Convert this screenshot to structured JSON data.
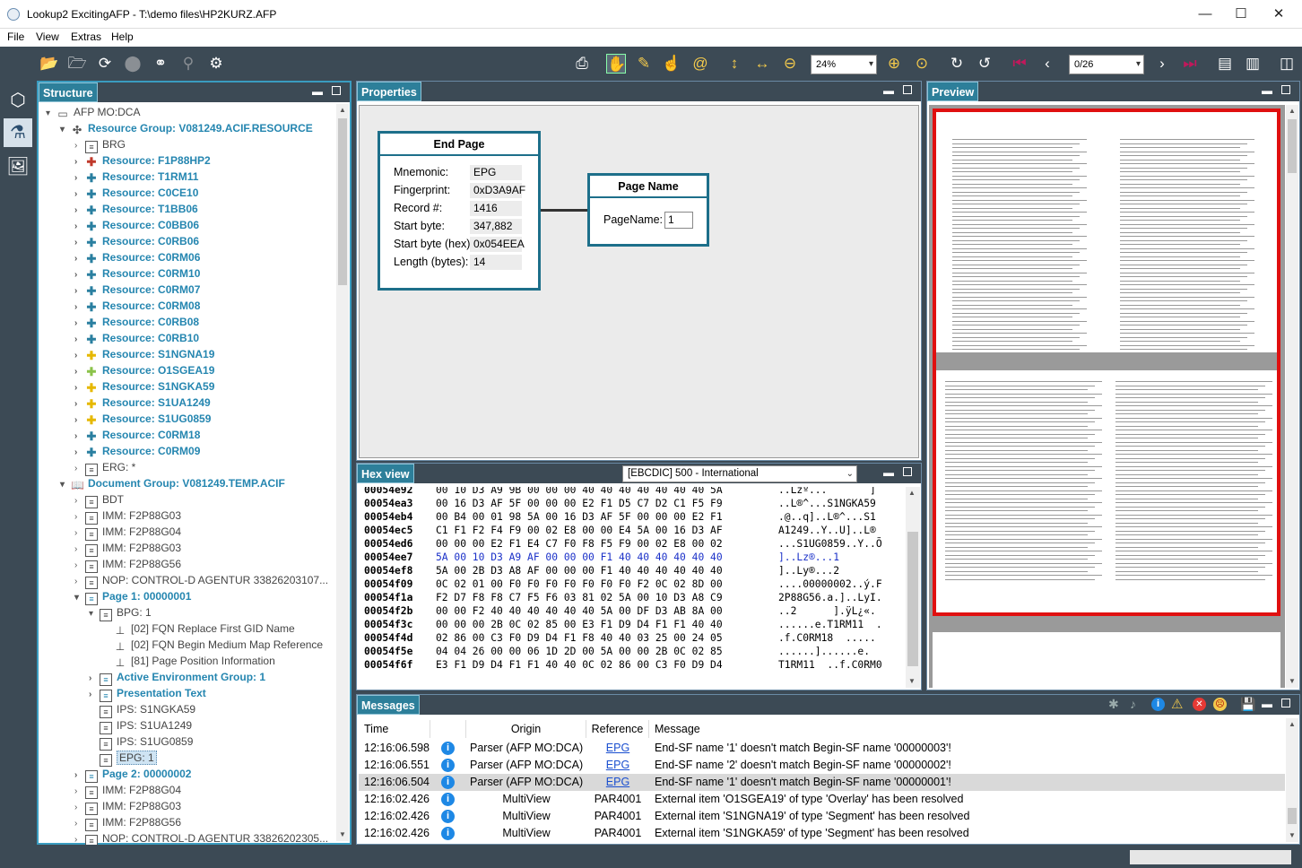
{
  "window": {
    "title": "Lookup2 ExcitingAFP - T:\\demo files\\HP2KURZ.AFP",
    "minimize": "—",
    "maximize": "☐",
    "close": "✕"
  },
  "menu": [
    "File",
    "View",
    "Extras",
    "Help"
  ],
  "toolbar": {
    "zoom": "24%",
    "page": "0/26"
  },
  "structure": {
    "title": "Structure",
    "nodes": [
      {
        "label": "AFP MO:DCA",
        "icon": "afp-file-icon",
        "style": "norm",
        "twisty": "▾",
        "indent": 0
      },
      {
        "label": "Resource Group: V081249.ACIF.RESOURCE",
        "icon": "resource-group-icon",
        "style": "bold",
        "twisty": "▾",
        "indent": 1
      },
      {
        "label": "BRG",
        "icon": "doc",
        "style": "norm",
        "twisty": "›",
        "indent": 2
      },
      {
        "label": "Resource: F1P88HP2",
        "icon": "pzr",
        "style": "bold",
        "twisty": "›",
        "indent": 2
      },
      {
        "label": "Resource: T1RM11",
        "icon": "pz",
        "style": "bold",
        "twisty": "›",
        "indent": 2
      },
      {
        "label": "Resource: C0CE10",
        "icon": "pz",
        "style": "bold",
        "twisty": "›",
        "indent": 2
      },
      {
        "label": "Resource: T1BB06",
        "icon": "pz",
        "style": "bold",
        "twisty": "›",
        "indent": 2
      },
      {
        "label": "Resource: C0BB06",
        "icon": "pz",
        "style": "bold",
        "twisty": "›",
        "indent": 2
      },
      {
        "label": "Resource: C0RB06",
        "icon": "pz",
        "style": "bold",
        "twisty": "›",
        "indent": 2
      },
      {
        "label": "Resource: C0RM06",
        "icon": "pz",
        "style": "bold",
        "twisty": "›",
        "indent": 2
      },
      {
        "label": "Resource: C0RM10",
        "icon": "pz",
        "style": "bold",
        "twisty": "›",
        "indent": 2
      },
      {
        "label": "Resource: C0RM07",
        "icon": "pz",
        "style": "bold",
        "twisty": "›",
        "indent": 2
      },
      {
        "label": "Resource: C0RM08",
        "icon": "pz",
        "style": "bold",
        "twisty": "›",
        "indent": 2
      },
      {
        "label": "Resource: C0RB08",
        "icon": "pz",
        "style": "bold",
        "twisty": "›",
        "indent": 2
      },
      {
        "label": "Resource: C0RB10",
        "icon": "pz",
        "style": "bold",
        "twisty": "›",
        "indent": 2
      },
      {
        "label": "Resource: S1NGNA19",
        "icon": "pzy",
        "style": "bold",
        "twisty": "›",
        "indent": 2
      },
      {
        "label": "Resource: O1SGEA19",
        "icon": "pzg",
        "style": "bold",
        "twisty": "›",
        "indent": 2
      },
      {
        "label": "Resource: S1NGKA59",
        "icon": "pzy",
        "style": "bold",
        "twisty": "›",
        "indent": 2
      },
      {
        "label": "Resource: S1UA1249",
        "icon": "pzy",
        "style": "bold",
        "twisty": "›",
        "indent": 2
      },
      {
        "label": "Resource: S1UG0859",
        "icon": "pzy",
        "style": "bold",
        "twisty": "›",
        "indent": 2
      },
      {
        "label": "Resource: C0RM18",
        "icon": "pz",
        "style": "bold",
        "twisty": "›",
        "indent": 2
      },
      {
        "label": "Resource: C0RM09",
        "icon": "pz",
        "style": "bold",
        "twisty": "›",
        "indent": 2
      },
      {
        "label": "ERG: *",
        "icon": "doc",
        "style": "norm",
        "twisty": "›",
        "indent": 2
      },
      {
        "label": "Document Group: V081249.TEMP.ACIF",
        "icon": "book-icon",
        "style": "bold",
        "twisty": "▾",
        "indent": 1
      },
      {
        "label": "BDT",
        "icon": "doc",
        "style": "norm",
        "twisty": "›",
        "indent": 2
      },
      {
        "label": "IMM: F2P88G03",
        "icon": "doc",
        "style": "norm",
        "twisty": "›",
        "indent": 2
      },
      {
        "label": "IMM: F2P88G04",
        "icon": "doc",
        "style": "norm",
        "twisty": "›",
        "indent": 2
      },
      {
        "label": "IMM: F2P88G03",
        "icon": "doc",
        "style": "norm",
        "twisty": "›",
        "indent": 2
      },
      {
        "label": "IMM: F2P88G56",
        "icon": "doc",
        "style": "norm",
        "twisty": "›",
        "indent": 2
      },
      {
        "label": "NOP: CONTROL-D AGENTUR  33826203107...",
        "icon": "doc",
        "style": "norm",
        "twisty": "›",
        "indent": 2
      },
      {
        "label": "Page 1: 00000001",
        "icon": "doc",
        "style": "bold",
        "twisty": "▾",
        "indent": 2
      },
      {
        "label": "BPG: 1",
        "icon": "doc",
        "style": "norm",
        "twisty": "▾",
        "indent": 3
      },
      {
        "label": "[02] FQN Replace First GID Name",
        "icon": "triplet",
        "style": "norm",
        "twisty": "",
        "indent": 4
      },
      {
        "label": "[02] FQN Begin Medium Map Reference",
        "icon": "triplet",
        "style": "norm",
        "twisty": "",
        "indent": 4
      },
      {
        "label": "[81] Page Position Information",
        "icon": "triplet",
        "style": "norm",
        "twisty": "",
        "indent": 4
      },
      {
        "label": "Active Environment Group: 1",
        "icon": "doc",
        "style": "bold",
        "twisty": "›",
        "indent": 3
      },
      {
        "label": "Presentation Text",
        "icon": "doc",
        "style": "bold",
        "twisty": "›",
        "indent": 3
      },
      {
        "label": "IPS: S1NGKA59",
        "icon": "doc",
        "style": "norm",
        "twisty": "",
        "indent": 3
      },
      {
        "label": "IPS: S1UA1249",
        "icon": "doc",
        "style": "norm",
        "twisty": "",
        "indent": 3
      },
      {
        "label": "IPS: S1UG0859",
        "icon": "doc",
        "style": "norm",
        "twisty": "",
        "indent": 3
      },
      {
        "label": "EPG: 1",
        "icon": "doc",
        "style": "sel",
        "twisty": "",
        "indent": 3
      },
      {
        "label": "Page 2: 00000002",
        "icon": "doc",
        "style": "bold",
        "twisty": "›",
        "indent": 2
      },
      {
        "label": "IMM: F2P88G04",
        "icon": "doc",
        "style": "norm",
        "twisty": "›",
        "indent": 2
      },
      {
        "label": "IMM: F2P88G03",
        "icon": "doc",
        "style": "norm",
        "twisty": "›",
        "indent": 2
      },
      {
        "label": "IMM: F2P88G56",
        "icon": "doc",
        "style": "norm",
        "twisty": "›",
        "indent": 2
      },
      {
        "label": "NOP: CONTROL-D AGENTUR  33826202305...",
        "icon": "doc",
        "style": "norm",
        "twisty": "›",
        "indent": 2
      }
    ]
  },
  "properties": {
    "title": "Properties",
    "end_page": {
      "header": "End Page",
      "fields": [
        {
          "label": "Mnemonic:",
          "value": "EPG"
        },
        {
          "label": "Fingerprint:",
          "value": "0xD3A9AF"
        },
        {
          "label": "Record #:",
          "value": "1416"
        },
        {
          "label": "Start byte:",
          "value": "347,882"
        },
        {
          "label": "Start byte (hex):",
          "value": "0x054EEA"
        },
        {
          "label": "Length (bytes):",
          "value": "14"
        }
      ]
    },
    "page_name": {
      "header": "Page Name",
      "label": "PageName:",
      "value": "1"
    }
  },
  "hexview": {
    "title": "Hex view",
    "encoding": "[EBCDIC] 500  - International",
    "rows": [
      {
        "addr": "00054e92",
        "bytes": "00 10 D3 A9 9B 00 00 00 40 40 40 40 40 40 40 5A",
        "text": "..Lzº...       ]"
      },
      {
        "addr": "00054ea3",
        "bytes": "00 16 D3 AF 5F 00 00 00 E2 F1 D5 C7 D2 C1 F5 F9",
        "text": "..L®^...S1NGKA59"
      },
      {
        "addr": "00054eb4",
        "bytes": "00 B4 00 01 98 5A 00 16 D3 AF 5F 00 00 00 E2 F1",
        "text": ".@..q]..L®^...S1"
      },
      {
        "addr": "00054ec5",
        "bytes": "C1 F1 F2 F4 F9 00 02 E8 00 00 E4 5A 00 16 D3 AF",
        "text": "A1249..Y..U]..L®"
      },
      {
        "addr": "00054ed6",
        "bytes": "00 00 00 E2 F1 E4 C7 F0 F8 F5 F9 00 02 E8 00 02",
        "text": "...S1UG0859..Y..Õ"
      },
      {
        "addr": "00054ee7",
        "bytes": "5A 00 10 D3 A9 AF 00 00 00 F1 40 40 40 40 40 40",
        "text": "]..Lz®...1      "
      },
      {
        "addr": "00054ef8",
        "bytes": "5A 00 2B D3 A8 AF 00 00 00 F1 40 40 40 40 40 40",
        "text": "]..Ly®...2      "
      },
      {
        "addr": "00054f09",
        "bytes": "0C 02 01 00 F0 F0 F0 F0 F0 F0 F0 F2 0C 02 8D 00",
        "text": "....00000002..ý.F"
      },
      {
        "addr": "00054f1a",
        "bytes": "F2 D7 F8 F8 C7 F5 F6 03 81 02 5A 00 10 D3 A8 C9",
        "text": "2P88G56.a.]..LyI."
      },
      {
        "addr": "00054f2b",
        "bytes": "00 00 F2 40 40 40 40 40 40 5A 00 DF D3 AB 8A 00",
        "text": "..2      ].ÿL¿«."
      },
      {
        "addr": "00054f3c",
        "bytes": "00 00 00 2B 0C 02 85 00 E3 F1 D9 D4 F1 F1 40 40",
        "text": "......e.T1RM11  ."
      },
      {
        "addr": "00054f4d",
        "bytes": "02 86 00 C3 F0 D9 D4 F1 F8 40 40 03 25 00 24 05",
        "text": ".f.C0RM18  ....."
      },
      {
        "addr": "00054f5e",
        "bytes": "04 04 26 00 00 06 1D 2D 00 5A 00 00 2B 0C 02 85",
        "text": "......]......e."
      },
      {
        "addr": "00054f6f",
        "bytes": "E3 F1 D9 D4 F1 F1 40 40 0C 02 86 00 C3 F0 D9 D4",
        "text": "T1RM11  ..f.C0RM0"
      }
    ]
  },
  "preview": {
    "title": "Preview"
  },
  "messages": {
    "title": "Messages",
    "columns": [
      "Time",
      "Origin",
      "Reference",
      "Message"
    ],
    "rows": [
      {
        "time": "12:16:06.598",
        "origin": "Parser (AFP MO:DCA)",
        "ref": "EPG",
        "link": true,
        "msg": "End-SF name '1' doesn't match Begin-SF name '00000003'!"
      },
      {
        "time": "12:16:06.551",
        "origin": "Parser (AFP MO:DCA)",
        "ref": "EPG",
        "link": true,
        "msg": "End-SF name '2' doesn't match Begin-SF name '00000002'!"
      },
      {
        "time": "12:16:06.504",
        "origin": "Parser (AFP MO:DCA)",
        "ref": "EPG",
        "link": true,
        "msg": "End-SF name '1' doesn't match Begin-SF name '00000001'!"
      },
      {
        "time": "12:16:02.426",
        "origin": "MultiView",
        "ref": "PAR4001",
        "link": false,
        "msg": "External item 'O1SGEA19' of type 'Overlay' has been resolved"
      },
      {
        "time": "12:16:02.426",
        "origin": "MultiView",
        "ref": "PAR4001",
        "link": false,
        "msg": "External item 'S1NGNA19' of type 'Segment' has been resolved"
      },
      {
        "time": "12:16:02.426",
        "origin": "MultiView",
        "ref": "PAR4001",
        "link": false,
        "msg": "External item 'S1NGKA59' of type 'Segment' has been resolved"
      }
    ]
  },
  "colors": {
    "accent": "#2d7f9a",
    "chrome": "#3c4a55",
    "selection_red": "#e01010"
  }
}
